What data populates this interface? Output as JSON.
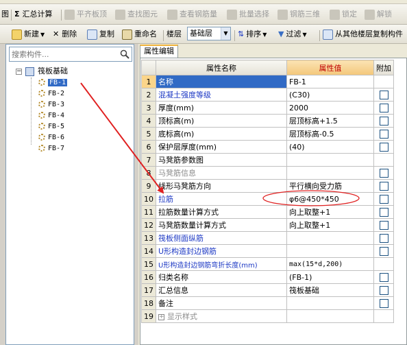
{
  "toolbar1": {
    "first": "图",
    "sigma": "Σ",
    "summary": "汇总计算",
    "align": "平齐板顶",
    "find": "查找图元",
    "view_rebar": "查看钢筋量",
    "batch_select": "批量选择",
    "rebar_3d": "钢筋三维",
    "lock": "锁定",
    "unlock": "解锁"
  },
  "toolbar2": {
    "new": "新建",
    "delete": "删除",
    "copy": "复制",
    "rename": "重命名",
    "floor_label": "楼层",
    "floor_value": "基础层",
    "sort": "排序",
    "filter": "过滤",
    "copy_from": "从其他楼层复制构件"
  },
  "search": {
    "placeholder": "搜索构件..."
  },
  "tree": {
    "root": "筏板基础",
    "items": [
      "FB-1",
      "FB-2",
      "FB-3",
      "FB-4",
      "FB-5",
      "FB-6",
      "FB-7"
    ]
  },
  "tab": {
    "label": "属性编辑"
  },
  "grid": {
    "headers": {
      "name": "属性名称",
      "value": "属性值",
      "extra": "附加"
    },
    "rows": [
      {
        "num": "1",
        "name": "名称",
        "value": "FB-1",
        "check": false
      },
      {
        "num": "2",
        "name": "混凝土强度等级",
        "value": "(C30)",
        "check": true
      },
      {
        "num": "3",
        "name": "厚度(mm)",
        "value": "2000",
        "check": true
      },
      {
        "num": "4",
        "name": "顶标高(m)",
        "value": "层顶标高+1.5",
        "check": true
      },
      {
        "num": "5",
        "name": "底标高(m)",
        "value": "层顶标高-0.5",
        "check": true
      },
      {
        "num": "6",
        "name": "保护层厚度(mm)",
        "value": "(40)",
        "check": true
      },
      {
        "num": "7",
        "name": "马凳筋参数图",
        "value": "",
        "check": false
      },
      {
        "num": "8",
        "name": "马凳筋信息",
        "value": "",
        "check": true
      },
      {
        "num": "9",
        "name": "线形马凳筋方向",
        "value": "平行横向受力筋",
        "check": true
      },
      {
        "num": "10",
        "name": "拉筋",
        "value": "φ6@450*450",
        "check": true
      },
      {
        "num": "11",
        "name": "拉筋数量计算方式",
        "value": "向上取整+1",
        "check": true
      },
      {
        "num": "12",
        "name": "马凳筋数量计算方式",
        "value": "向上取整+1",
        "check": true
      },
      {
        "num": "13",
        "name": "筏板侧面纵筋",
        "value": "",
        "check": true
      },
      {
        "num": "14",
        "name": "U形构造封边钢筋",
        "value": "",
        "check": true
      },
      {
        "num": "15",
        "name": "U形构造封边钢筋弯折长度(mm)",
        "value": "max(15*d,200)",
        "check": false
      },
      {
        "num": "16",
        "name": "归类名称",
        "value": "(FB-1)",
        "check": true
      },
      {
        "num": "17",
        "name": "汇总信息",
        "value": "筏板基础",
        "check": true
      },
      {
        "num": "18",
        "name": "备注",
        "value": "",
        "check": true
      },
      {
        "num": "19",
        "name": "显示样式",
        "value": "",
        "check": false
      }
    ]
  },
  "colors": {
    "selection": "#316ac5",
    "annotation": "#e02020",
    "link_text": "#1c38c4",
    "value_header": "#c00000"
  }
}
